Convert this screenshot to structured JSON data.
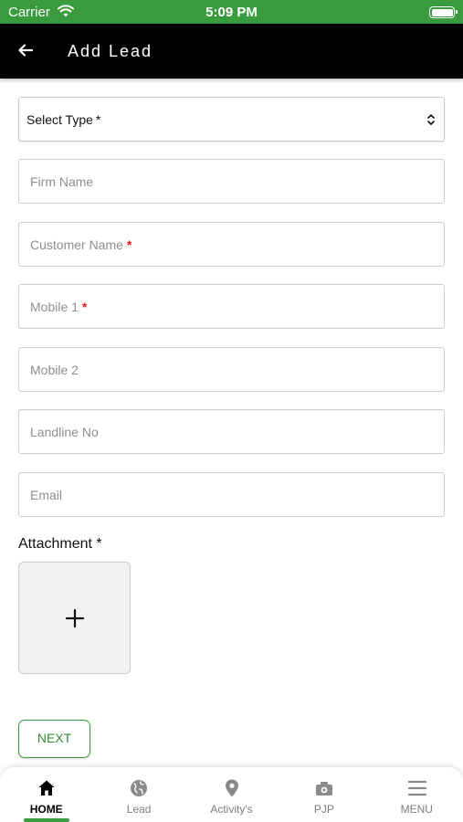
{
  "status_bar": {
    "carrier": "Carrier",
    "time": "5:09 PM"
  },
  "header": {
    "title": "Add Lead",
    "back_icon": "arrow-left-icon"
  },
  "form": {
    "select_type": {
      "label": "Select Type",
      "required_mark": "*"
    },
    "fields": [
      {
        "placeholder": "Firm Name",
        "required": ""
      },
      {
        "placeholder": "Customer Name",
        "required": "*"
      },
      {
        "placeholder": "Mobile 1",
        "required": "*"
      },
      {
        "placeholder": "Mobile 2",
        "required": ""
      },
      {
        "placeholder": "Landline No",
        "required": ""
      },
      {
        "placeholder": "Email",
        "required": ""
      }
    ],
    "attachment_label": "Attachment *",
    "next_label": "NEXT"
  },
  "bottom_nav": {
    "items": [
      {
        "label": "HOME",
        "icon": "home-icon",
        "active": true
      },
      {
        "label": "Lead",
        "icon": "globe-icon",
        "active": false
      },
      {
        "label": "Activity's",
        "icon": "location-pin-icon",
        "active": false
      },
      {
        "label": "PJP",
        "icon": "camera-icon",
        "active": false
      },
      {
        "label": "MENU",
        "icon": "menu-icon",
        "active": false
      }
    ]
  },
  "colors": {
    "brand_green": "#3a9b3e",
    "header_bg": "#000000",
    "required_red": "#e01e1e"
  }
}
